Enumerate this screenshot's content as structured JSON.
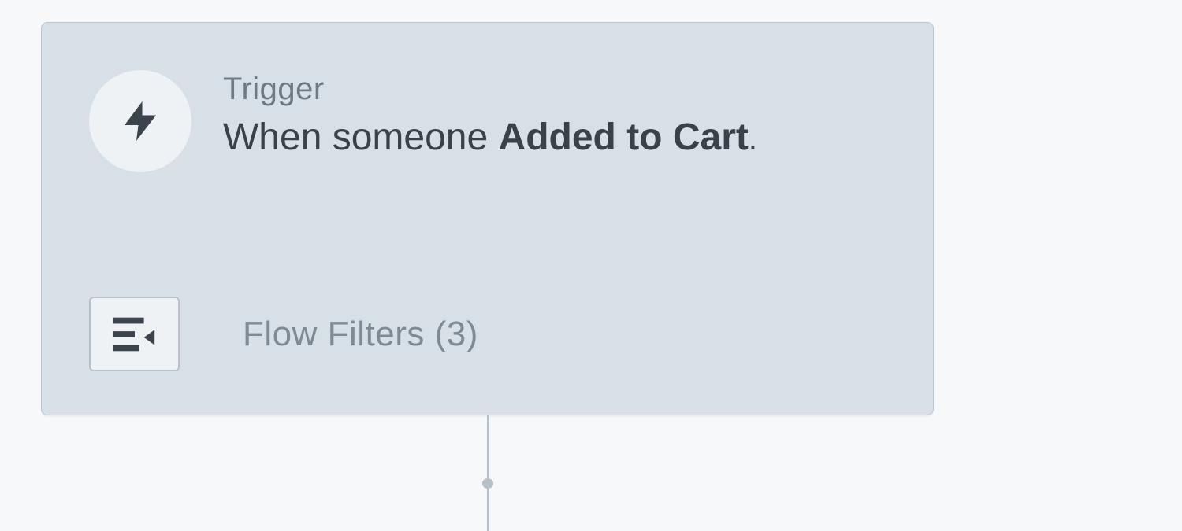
{
  "trigger": {
    "label": "Trigger",
    "description_prefix": "When someone ",
    "description_bold": "Added to Cart",
    "period": "."
  },
  "filters": {
    "label": "Flow Filters (3)",
    "count": 3
  },
  "icons": {
    "trigger": "bolt-icon",
    "filters": "filter-list-icon"
  },
  "colors": {
    "card_bg": "#d7e0e7",
    "card_border": "#b9c6cf",
    "canvas_bg": "#f6f8fa",
    "text_primary": "#3a4249",
    "text_secondary": "#6e7a83",
    "connector": "#b6c0c8"
  }
}
